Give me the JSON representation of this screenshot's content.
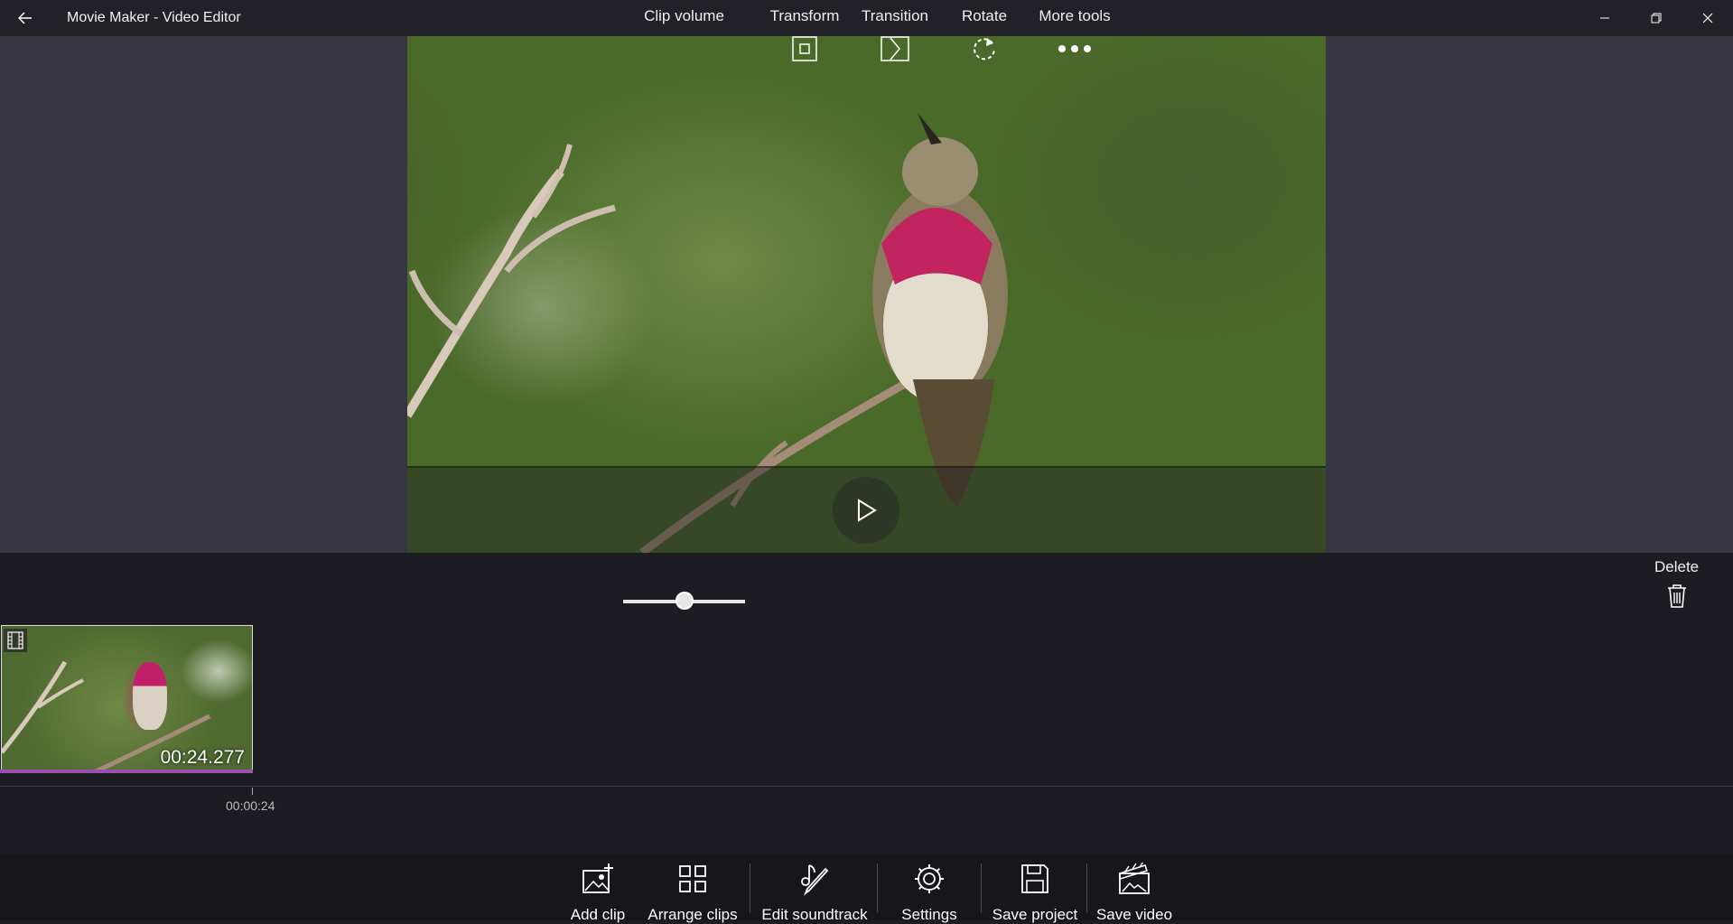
{
  "window": {
    "title": "Movie Maker - Video Editor",
    "back_icon": "back-arrow-icon",
    "controls": [
      "minimize-icon",
      "restore-icon",
      "close-icon"
    ]
  },
  "preview": {
    "play_icon": "play-icon"
  },
  "tools": {
    "clip_volume": "Clip volume",
    "transform": "Transform",
    "transition": "Transition",
    "rotate": "Rotate",
    "more_tools": "More tools",
    "delete": "Delete",
    "volume_level": 0.5
  },
  "timeline": {
    "clip_duration": "00:24.277",
    "tick_label": "00:00:24"
  },
  "bottom": {
    "add_clip": "Add clip",
    "arrange_clips": "Arrange clips",
    "edit_soundtrack": "Edit soundtrack",
    "settings": "Settings",
    "save_project": "Save project",
    "save_video": "Save video"
  },
  "colors": {
    "accent": "#9b4fb3",
    "background": "#1c1c22",
    "preview_bg": "#363541"
  }
}
